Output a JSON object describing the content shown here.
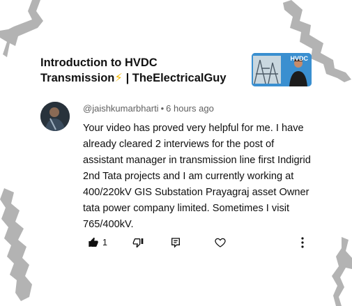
{
  "video": {
    "title_line1": "Introduction to HVDC",
    "title_line2_prefix": "Transmission",
    "title_line2_emoji": "⚡",
    "title_line2_suffix": "| TheElectricalGuy",
    "thumbnail_label": "HVDC"
  },
  "comment": {
    "author": "@jaishkumarbharti",
    "separator": "•",
    "time": "6 hours ago",
    "text": "Your video has proved very helpful for me. I have already cleared 2 interviews for the post of assistant manager in transmission line first Indigrid 2nd Tata projects and I am currently working at 400/220kV GIS Substation Prayagraj asset Owner tata power company limited. Sometimes I visit 765/400kV.",
    "like_count": "1"
  },
  "icons": {
    "like": "thumbs-up-icon",
    "dislike": "thumbs-down-icon",
    "reply": "reply-icon",
    "heart": "heart-icon",
    "more": "more-vertical-icon"
  },
  "colors": {
    "text_primary": "#0f0f0f",
    "text_secondary": "#606060",
    "decoration_gray": "#b3b3b3",
    "emoji_yellow": "#f5b800",
    "thumbnail_blue": "#3a8fd0"
  }
}
